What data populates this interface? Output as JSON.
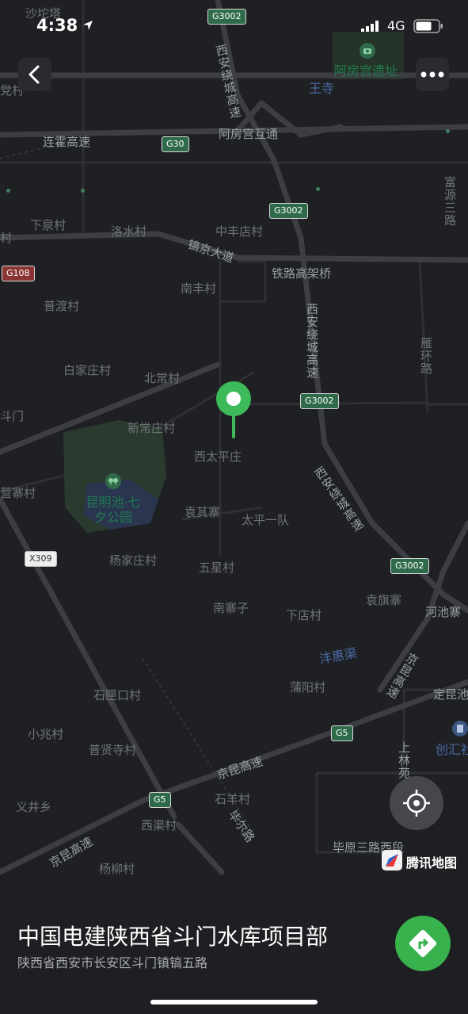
{
  "status_bar": {
    "time": "4:38",
    "carrier": "4G"
  },
  "map": {
    "labels": {
      "shahexian": "沙坨塔",
      "epanggong_site": "阿房宫遗址",
      "wangsi": "王寺",
      "dangcun": "党村",
      "lianhuo": "连霍高速",
      "epanggong_interchange": "阿房宫互通",
      "fuyuan": "富源三路",
      "xiaquan": "下泉村",
      "luoshui": "洛水村",
      "zhongfeng": "中丰店村",
      "cun_left": "村",
      "haojing": "镐京大道",
      "railway_bridge": "铁路高架桥",
      "nanfeng": "南丰村",
      "pudu": "普渡村",
      "ring_north": "西安绕城高速",
      "ring_mid": "西安绕城高速",
      "ring_south": "西安绕城高速",
      "yanhuan": "雁环路",
      "baijiazhuang": "白家庄村",
      "beichang": "北常村",
      "doumen": "斗门",
      "xinchangzhuang": "新常庄村",
      "xitaiping": "西太平庄",
      "yingzhai": "营寨村",
      "kunmingchi": "昆明池·七夕公园",
      "yuanqizhai": "袁其寨",
      "taiping_yidui": "太平一队",
      "yangjiazhuang": "杨家庄村",
      "wuxing": "五星村",
      "nanzhaizi": "南寨子",
      "xiadian": "下店村",
      "yuanqizhai2": "袁旗寨",
      "hechizhai": "河池寨",
      "fenghui": "沣惠渠",
      "jingkun_east": "京昆高速",
      "puyang": "蒲阳村",
      "dingkun": "定昆池",
      "shiyankou": "石匣口村",
      "xiaozhao": "小兆村",
      "puxiansi": "普贤寺村",
      "chuanghui": "创汇社",
      "shanglin": "上林苑",
      "jingkun_mid": "京昆高速",
      "yijingxiang": "义井乡",
      "shiyang": "石羊村",
      "bixian": "毕尔路",
      "xiqu": "西渠村",
      "biyuan": "毕原三路西段",
      "jingkun_sw": "京昆高速",
      "yangliu": "杨柳村"
    },
    "shields": {
      "g3002_top": "G3002",
      "g30": "G30",
      "g3002_a": "G3002",
      "g108": "G108",
      "g3002_b": "G3002",
      "x309": "X309",
      "g3002_c": "G3002",
      "g5_a": "G5",
      "g5_b": "G5"
    },
    "brand": "腾讯地图"
  },
  "poi": {
    "name": "中国电建陕西省斗门水库项目部",
    "address": "陕西省西安市长安区斗门镇镐五路"
  },
  "icons": {
    "back": "back-arrow-icon",
    "more": "more-dots-icon",
    "locate": "locate-icon",
    "navigate": "navigate-icon",
    "pin": "map-pin-icon",
    "signal": "signal-icon",
    "battery": "battery-icon",
    "location_arrow": "location-arrow-icon"
  },
  "colors": {
    "pin": "#3dbb5a",
    "navigate": "#37b24d",
    "park": "#2a3a2e",
    "water": "#2a3550"
  }
}
